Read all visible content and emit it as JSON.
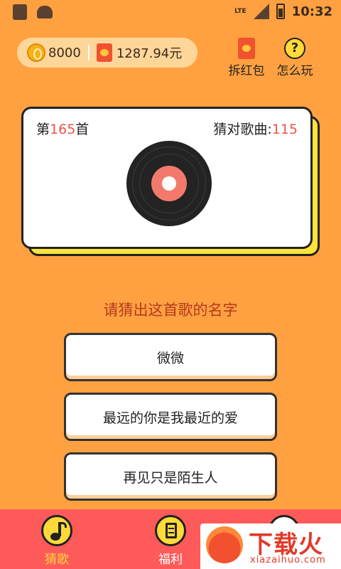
{
  "status_bar": {
    "network": "LTE",
    "time": "10:32"
  },
  "wallet": {
    "coins": "8000",
    "cash": "1287.94元"
  },
  "actions": {
    "redpacket_label": "拆红包",
    "help_label": "怎么玩",
    "help_symbol": "?"
  },
  "card": {
    "song_prefix": "第",
    "song_number": "165",
    "song_suffix": "首",
    "correct_label": "猜对歌曲:",
    "correct_count": "115"
  },
  "question": "请猜出这首歌的名字",
  "options": [
    {
      "label": "微微"
    },
    {
      "label": "最远的你是我最近的爱"
    },
    {
      "label": "再见只是陌生人"
    }
  ],
  "tabs": [
    {
      "label": "猜歌",
      "icon": "music-note-icon",
      "active": true
    },
    {
      "label": "福利",
      "icon": "clipboard-icon",
      "active": false
    },
    {
      "label": "",
      "icon": "tab-icon",
      "active": false
    }
  ],
  "watermark": {
    "title": "下载火",
    "subtitle": "xiazaihuo.com"
  },
  "colors": {
    "background": "#FFA140",
    "accent_red": "#F0524A",
    "tabbar": "#FF5A5A",
    "yellow": "#FFD93A"
  }
}
